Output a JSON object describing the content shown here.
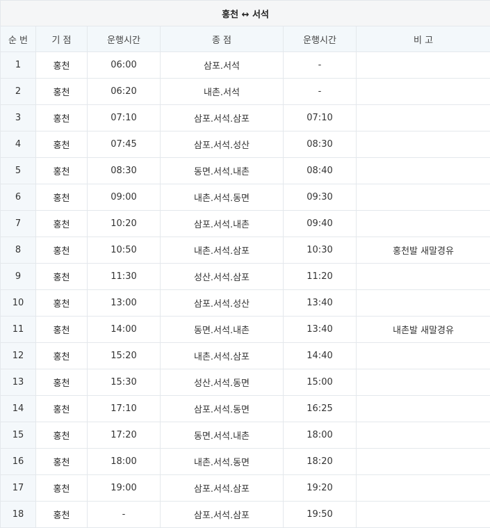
{
  "table": {
    "title": "홍천 ↔ 서석",
    "headers": [
      "순 번",
      "기 점",
      "운행시간",
      "종 점",
      "운행시간",
      "비 고"
    ],
    "rows": [
      [
        "1",
        "홍천",
        "06:00",
        "삼포.서석",
        "-",
        ""
      ],
      [
        "2",
        "홍천",
        "06:20",
        "내촌.서석",
        "-",
        ""
      ],
      [
        "3",
        "홍천",
        "07:10",
        "삼포.서석.삼포",
        "07:10",
        ""
      ],
      [
        "4",
        "홍천",
        "07:45",
        "삼포.서석.성산",
        "08:30",
        ""
      ],
      [
        "5",
        "홍천",
        "08:30",
        "동면.서석.내촌",
        "08:40",
        ""
      ],
      [
        "6",
        "홍천",
        "09:00",
        "내촌.서석.동면",
        "09:30",
        ""
      ],
      [
        "7",
        "홍천",
        "10:20",
        "삼포.서석.내촌",
        "09:40",
        ""
      ],
      [
        "8",
        "홍천",
        "10:50",
        "내촌.서석.삼포",
        "10:30",
        "홍천발 새말경유"
      ],
      [
        "9",
        "홍천",
        "11:30",
        "성산.서석.삼포",
        "11:20",
        ""
      ],
      [
        "10",
        "홍천",
        "13:00",
        "삼포.서석.성산",
        "13:40",
        ""
      ],
      [
        "11",
        "홍천",
        "14:00",
        "동면.서석.내촌",
        "13:40",
        "내촌발 새말경유"
      ],
      [
        "12",
        "홍천",
        "15:20",
        "내촌.서석.삼포",
        "14:40",
        ""
      ],
      [
        "13",
        "홍천",
        "15:30",
        "성산.서석.동면",
        "15:00",
        ""
      ],
      [
        "14",
        "홍천",
        "17:10",
        "삼포.서석.동면",
        "16:25",
        ""
      ],
      [
        "15",
        "홍천",
        "17:20",
        "동면.서석.내촌",
        "18:00",
        ""
      ],
      [
        "16",
        "홍천",
        "18:00",
        "내촌.서석.동면",
        "18:20",
        ""
      ],
      [
        "17",
        "홍천",
        "19:00",
        "삼포.서석.삼포",
        "19:20",
        ""
      ],
      [
        "18",
        "홍천",
        "-",
        "삼포.서석.삼포",
        "19:50",
        ""
      ]
    ]
  }
}
